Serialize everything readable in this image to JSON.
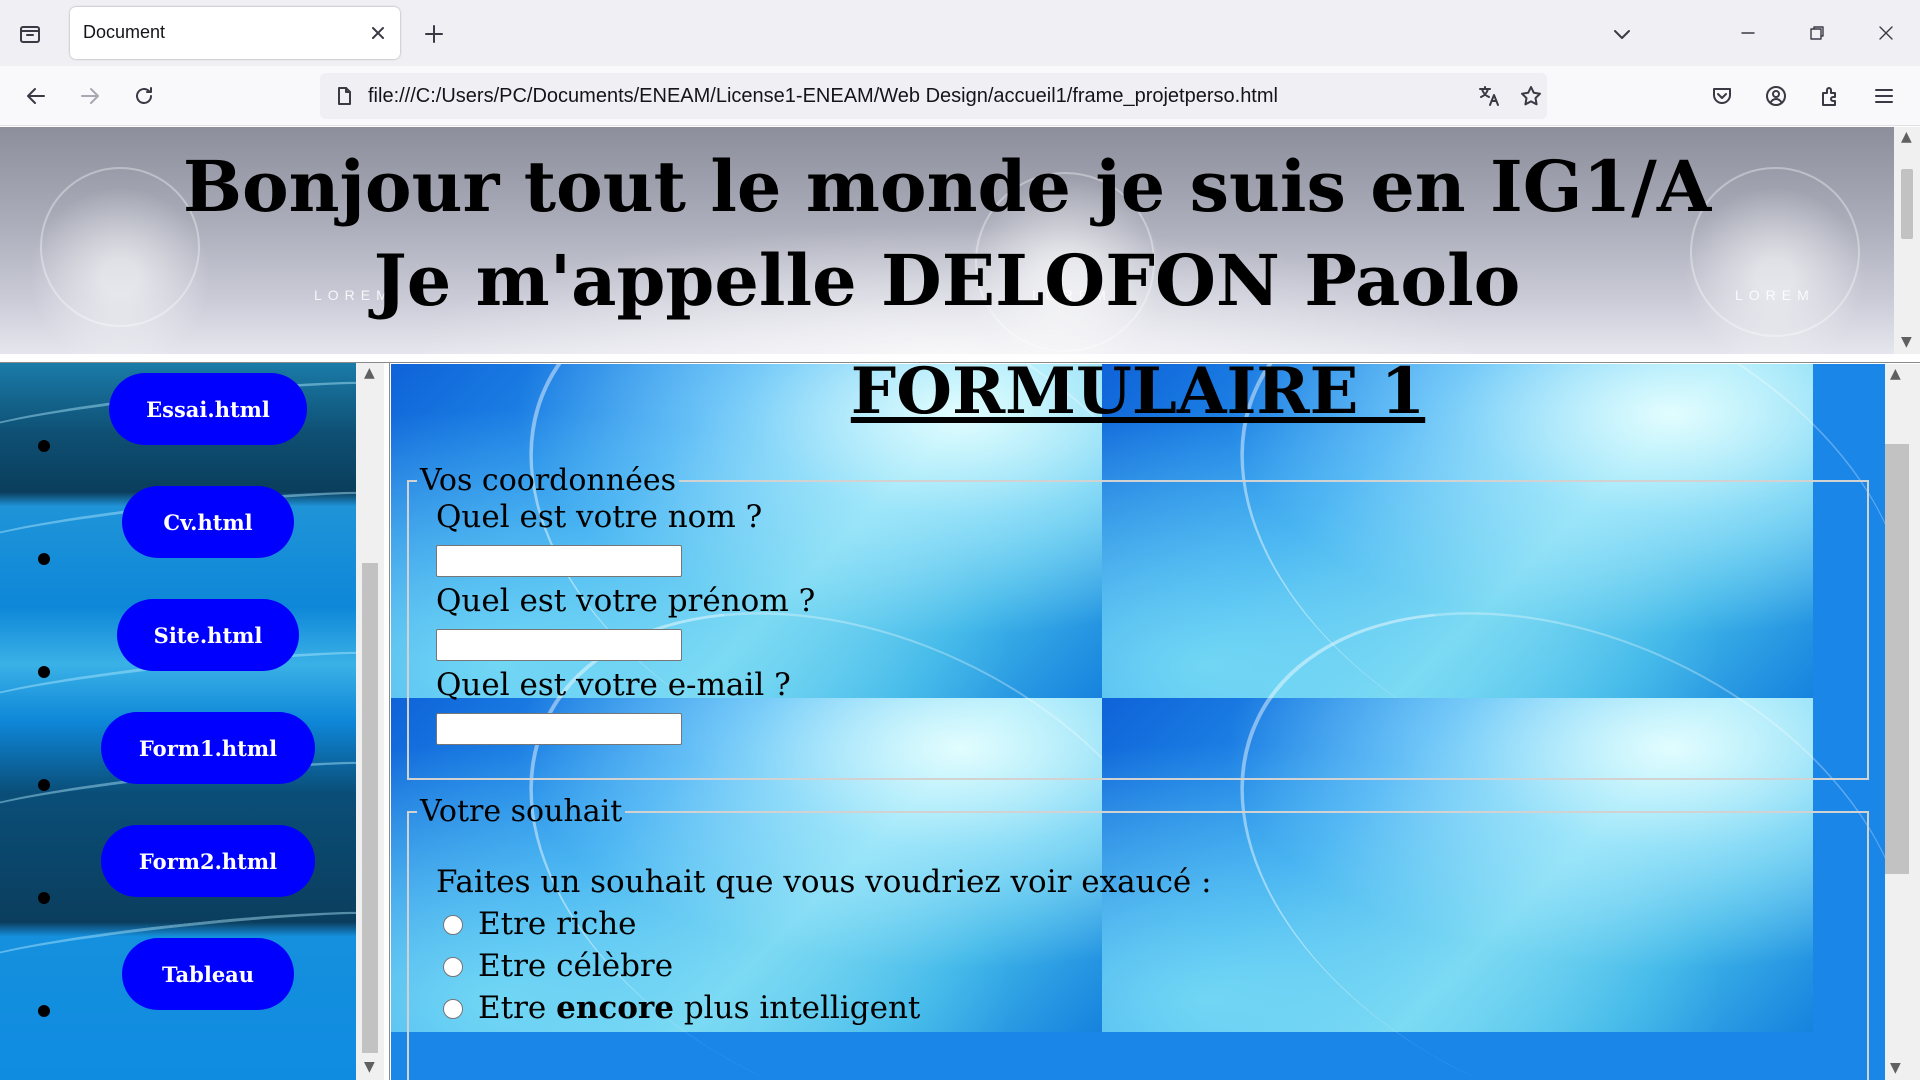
{
  "browser": {
    "tab_title": "Document",
    "url": "file:///C:/Users/PC/Documents/ENEAM/License1-ENEAM/Web Design/accueil1/frame_projetperso.html"
  },
  "header": {
    "line1": "Bonjour tout le monde je suis en IG1/A",
    "line2": "Je m'appelle DELOFON Paolo",
    "bg_text": "LOREM"
  },
  "nav": {
    "items": [
      {
        "label": "Essai.html"
      },
      {
        "label": "Cv.html"
      },
      {
        "label": "Site.html"
      },
      {
        "label": "Form1.html"
      },
      {
        "label": "Form2.html"
      },
      {
        "label": "Tableau"
      }
    ],
    "pill_color": "#0000ff"
  },
  "main": {
    "title": "FORMULAIRE 1",
    "coords": {
      "legend": "Vos coordonnées",
      "q_nom": "Quel est votre nom ?",
      "q_prenom": "Quel est votre prénom ?",
      "q_email": "Quel est votre e-mail ?"
    },
    "wish": {
      "legend": "Votre souhait",
      "question": "Faites un souhait que vous voudriez voir exaucé :",
      "opt1": "Etre riche",
      "opt2": "Etre célèbre",
      "opt3_pre": "Etre ",
      "opt3_bold": "encore",
      "opt3_post": " plus intelligent"
    }
  }
}
